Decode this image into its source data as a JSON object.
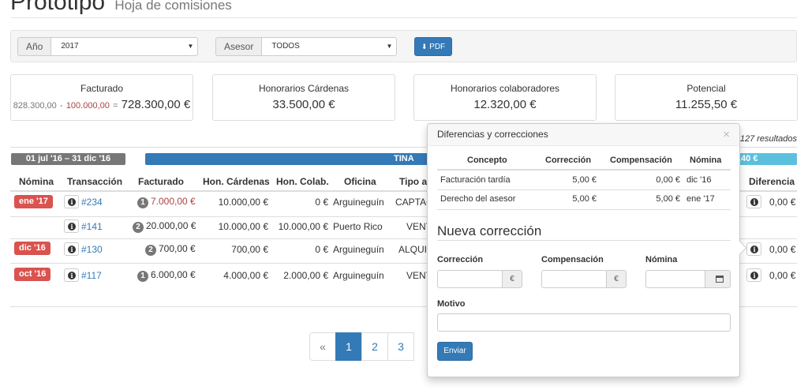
{
  "header": {
    "title": "Prototipo",
    "subtitle": "Hoja de comisiones"
  },
  "filters": {
    "year_label": "Año",
    "year_value": "2017",
    "advisor_label": "Asesor",
    "advisor_value": "TODOS",
    "pdf_label": "PDF"
  },
  "summary": [
    {
      "title": "Facturado",
      "sub_a": "828.300,00",
      "sub_op": "-",
      "sub_b": "100.000,00",
      "sub_eq": "=",
      "value": "728.300,00 €"
    },
    {
      "title": "Honorarios Cárdenas",
      "value": "33.500,00 €"
    },
    {
      "title": "Honorarios colaboradores",
      "value": "12.320,00 €"
    },
    {
      "title": "Potencial",
      "value": "11.255,50 €"
    }
  ],
  "results_text": "127 resultados",
  "bars": {
    "period": "01 jul '16 – 31 dic '16",
    "advisor": "TINA",
    "teal": ",40 €"
  },
  "table": {
    "headers": [
      "Nómina",
      "Transacción",
      "Facturado",
      "Hon. Cárdenas",
      "Hon. Colab.",
      "Oficina",
      "Tipo at",
      "Diferencia"
    ],
    "rows": [
      {
        "nomina": "ene '17",
        "trans": "#234",
        "count": "1",
        "facturado": "7.000,00 €",
        "hon_cardenas": "10.000,00 €",
        "hon_colab": "0 €",
        "oficina": "Arguineguín",
        "tipo": "CAPTAC",
        "diferencia": "0,00 €"
      },
      {
        "nomina": "",
        "trans": "#141",
        "count": "2",
        "facturado": "20.000,00 €",
        "hon_cardenas": "10.000,00 €",
        "hon_colab": "10.000,00 €",
        "oficina": "Puerto Rico",
        "tipo": "VENT",
        "diferencia": ""
      },
      {
        "nomina": "dic '16",
        "trans": "#130",
        "count": "2",
        "facturado": "700,00 €",
        "hon_cardenas": "700,00 €",
        "hon_colab": "0 €",
        "oficina": "Arguineguín",
        "tipo": "ALQUIL",
        "diferencia": "0,00 €"
      },
      {
        "nomina": "oct '16",
        "trans": "#117",
        "count": "1",
        "facturado": "6.000,00 €",
        "hon_cardenas": "4.000,00 €",
        "hon_colab": "2.000,00 €",
        "oficina": "Arguineguín",
        "tipo": "VENT",
        "diferencia": "0,00 €"
      }
    ]
  },
  "pagination": {
    "prev": "«",
    "pages": [
      "1",
      "2",
      "3"
    ]
  },
  "popover": {
    "title": "Diferencias y correcciones",
    "close": "×",
    "headers": [
      "Concepto",
      "Corrección",
      "Compensación",
      "Nómina"
    ],
    "rows": [
      {
        "concepto": "Facturación tardía",
        "correccion": "5,00 €",
        "compensacion": "0,00 €",
        "nomina": "dic '16"
      },
      {
        "concepto": "Derecho del asesor",
        "correccion": "5,00 €",
        "compensacion": "5,00 €",
        "nomina": "ene '17"
      }
    ],
    "form_title": "Nueva corrección",
    "correccion_label": "Corrección",
    "compensacion_label": "Compensación",
    "nomina_label": "Nómina",
    "motivo_label": "Motivo",
    "currency": "€",
    "submit": "Enviar"
  },
  "colors": {
    "primary": "#337ab7",
    "danger": "#d9534f",
    "info": "#5bc0de",
    "muted": "#777777"
  },
  "icons": [
    "info-icon",
    "calendar-icon",
    "pdf-icon",
    "caret-down-icon",
    "close-icon"
  ]
}
